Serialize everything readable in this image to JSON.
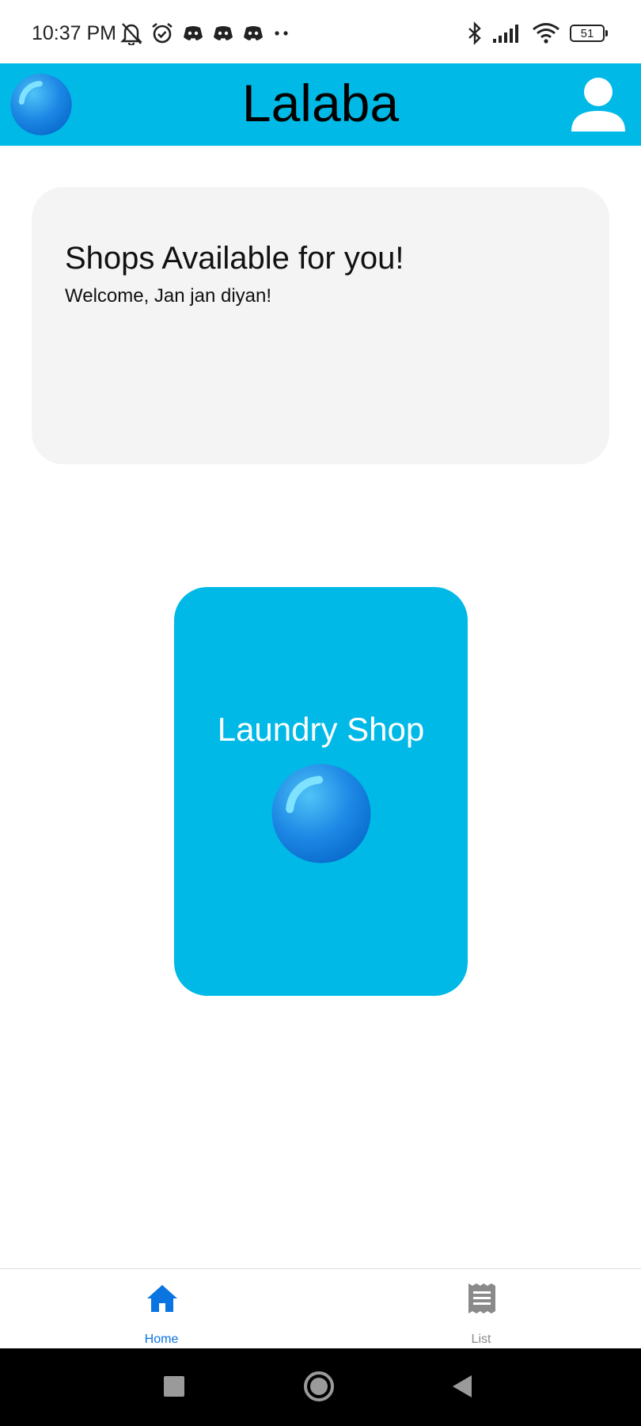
{
  "status_bar": {
    "time": "10:37 PM",
    "battery": "51",
    "icons_left": [
      "bell-off-icon",
      "alarm-icon",
      "discord-icon",
      "discord-icon",
      "discord-icon",
      "more-dots-icon"
    ],
    "icons_right": [
      "bluetooth-icon",
      "signal-icon",
      "wifi-icon",
      "battery-icon"
    ]
  },
  "header": {
    "title": "Lalaba",
    "logo_icon": "bubble-logo-icon",
    "profile_icon": "user-icon",
    "background_color": "#00b9e6"
  },
  "welcome_card": {
    "title": "Shops Available for you!",
    "subtitle": "Welcome, Jan jan diyan!"
  },
  "shops": [
    {
      "name": "Laundry Shop",
      "icon": "bubble-logo-icon"
    }
  ],
  "bottom_nav": {
    "items": [
      {
        "label": "Home",
        "icon": "home-icon",
        "active": true
      },
      {
        "label": "List",
        "icon": "list-icon",
        "active": false
      }
    ],
    "active_color": "#0a74e0",
    "inactive_color": "#8a8a8a"
  },
  "system_nav": [
    "recent-apps-icon",
    "home-circle-icon",
    "back-icon"
  ]
}
